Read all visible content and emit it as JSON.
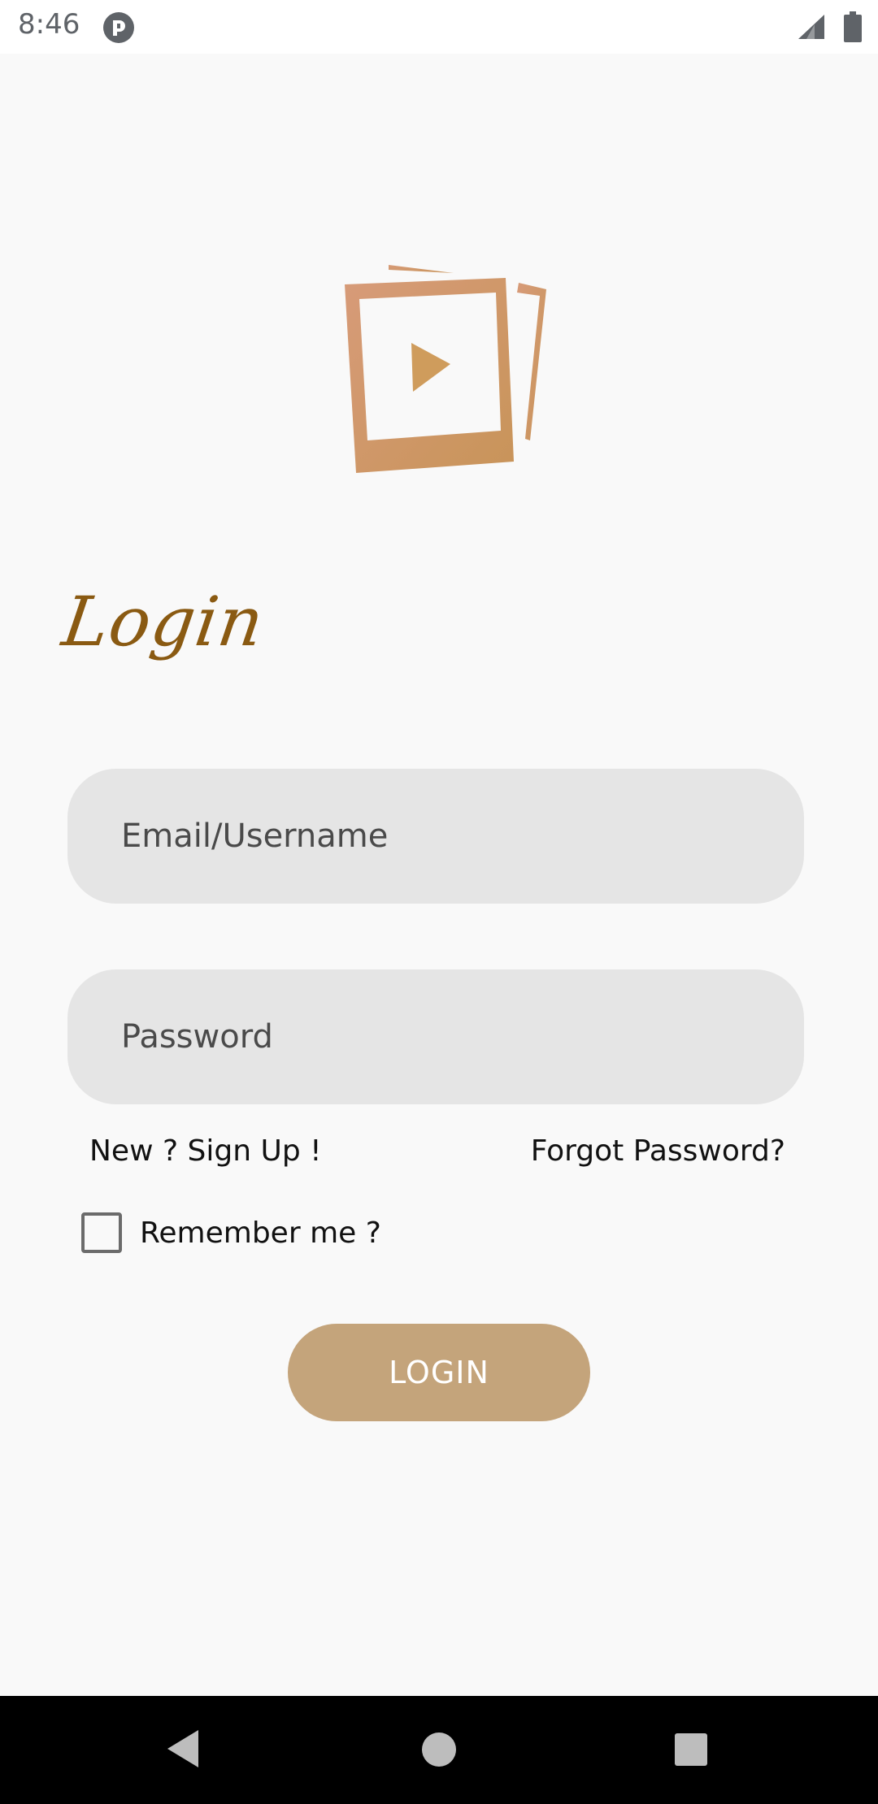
{
  "status_bar": {
    "time": "8:46",
    "icons": [
      "app-notification-icon",
      "signal-icon",
      "battery-icon"
    ]
  },
  "logo": {
    "icon": "photo-video-stack-icon",
    "colors": [
      "#d79b79",
      "#c89459"
    ]
  },
  "title": "Login",
  "form": {
    "email_placeholder": "Email/Username",
    "password_placeholder": "Password",
    "signup_link": "New ? Sign Up !",
    "forgot_link": "Forgot Password?",
    "remember_label": "Remember me ?",
    "remember_checked": false,
    "login_button": "LOGIN"
  },
  "colors": {
    "accent": "#c4a47b",
    "title": "#8a5a12",
    "field_bg": "#e5e5e5",
    "background": "#f9f9f9"
  },
  "nav_bar": {
    "icons": [
      "back-icon",
      "home-icon",
      "recents-icon"
    ]
  }
}
